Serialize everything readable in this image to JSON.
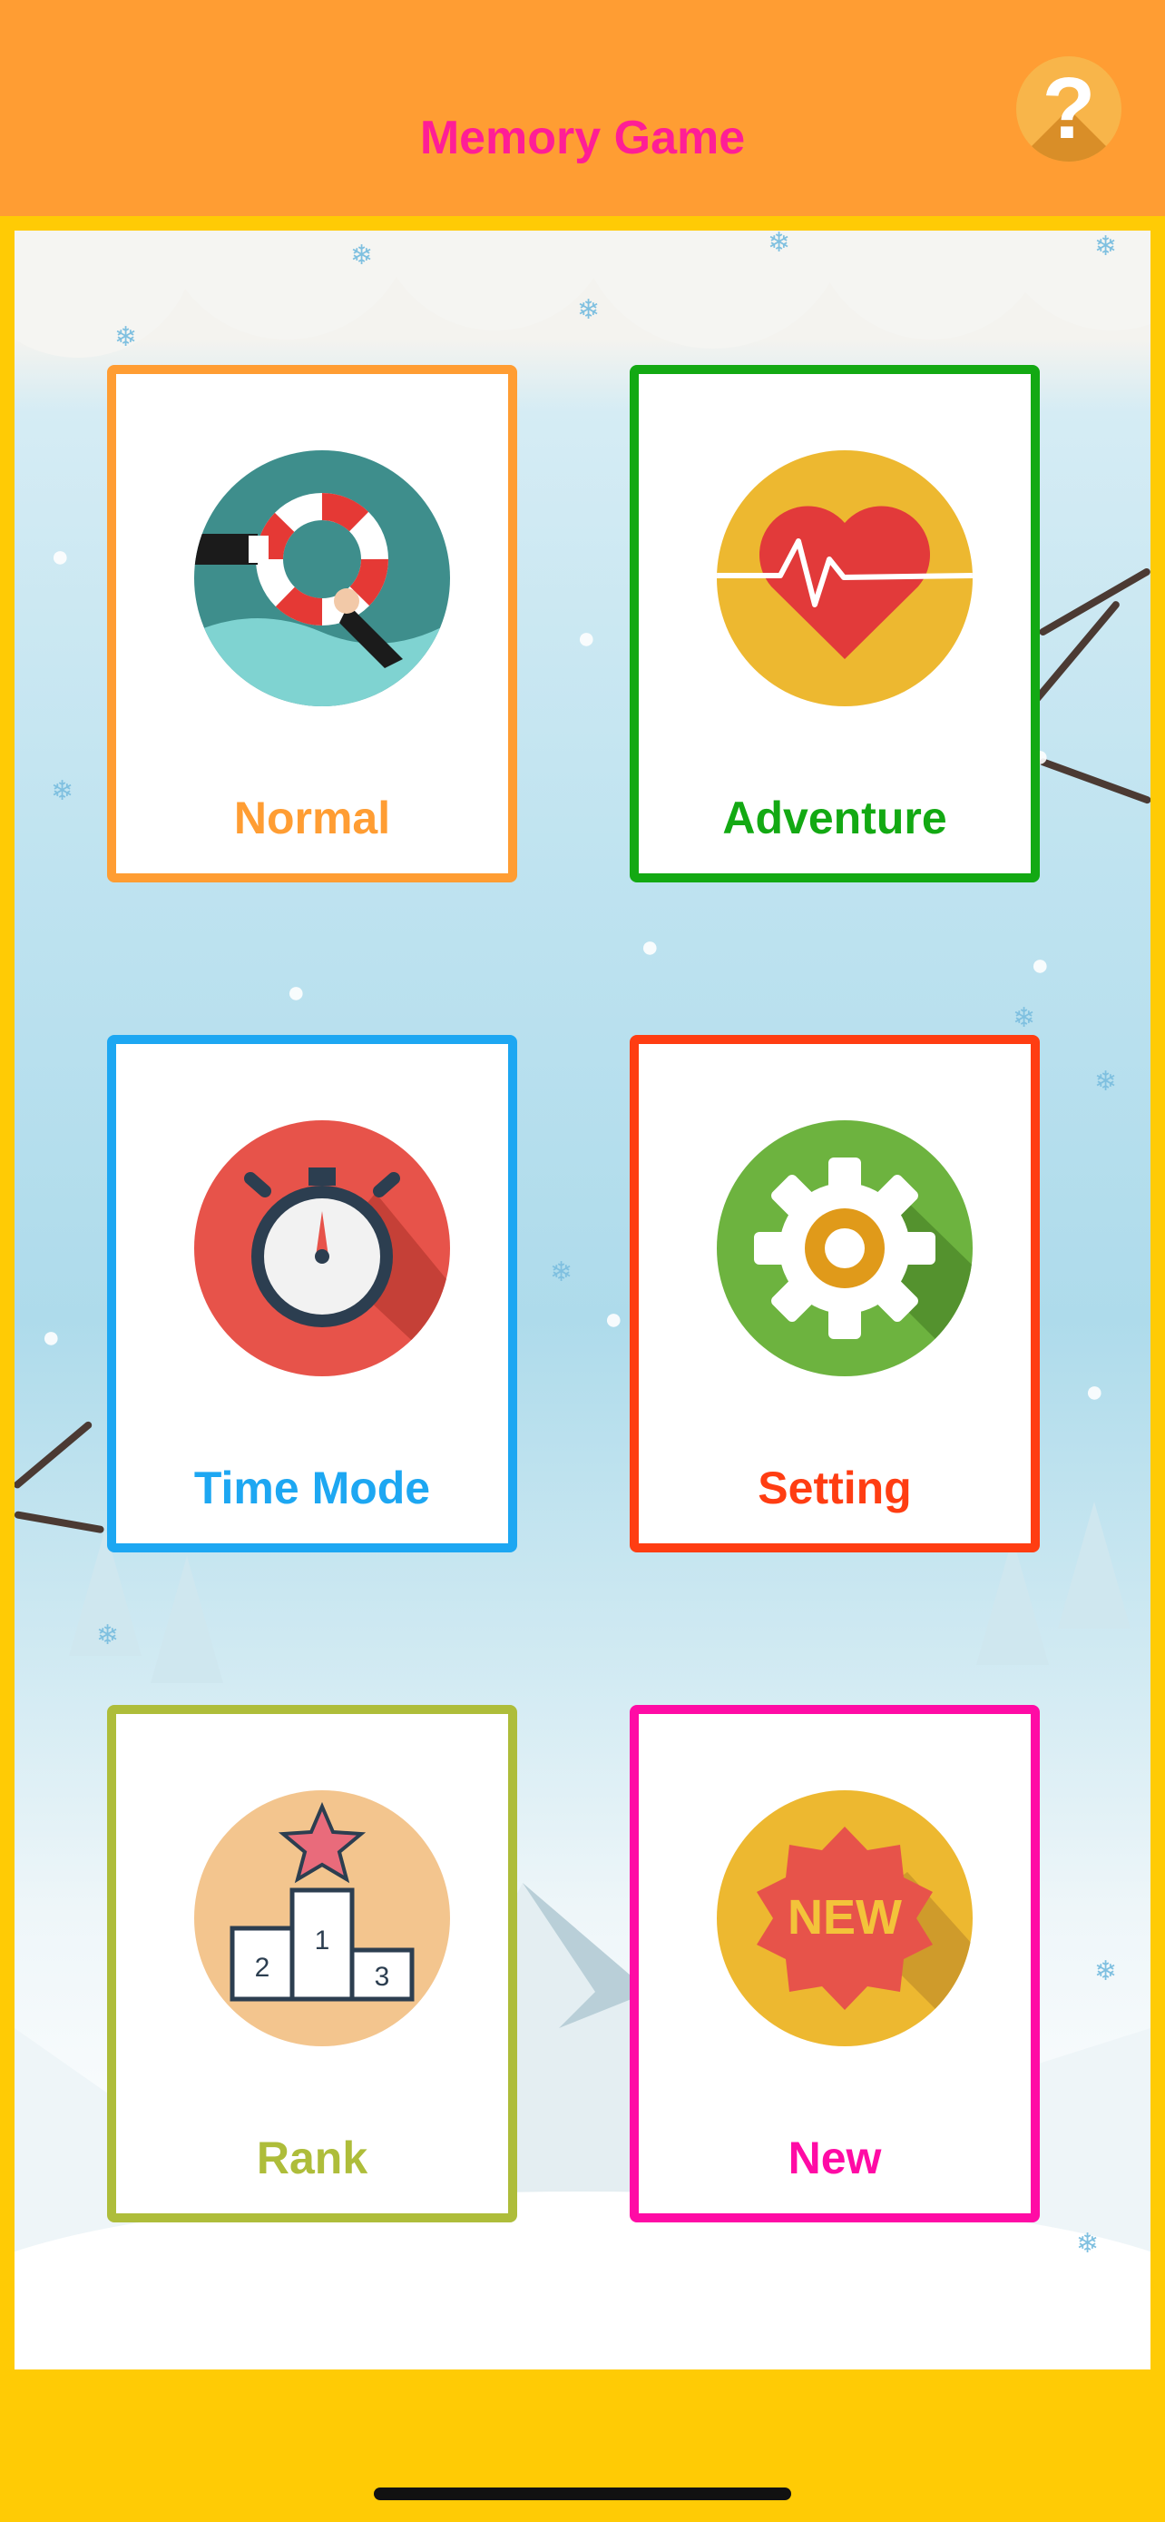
{
  "header": {
    "title": "Memory Game",
    "help_icon": "question-mark-icon",
    "help_glyph": "?"
  },
  "colors": {
    "header_bg": "#FF9D33",
    "title": "#FF1E96",
    "frame": "#FFCB05"
  },
  "menu": [
    {
      "id": "normal",
      "label": "Normal",
      "color": "#FF9D33",
      "icon": "lifebuoy-icon"
    },
    {
      "id": "adventure",
      "label": "Adventure",
      "color": "#13A913",
      "icon": "heartbeat-icon"
    },
    {
      "id": "time-mode",
      "label": "Time Mode",
      "color": "#1DA7F2",
      "icon": "stopwatch-icon"
    },
    {
      "id": "setting",
      "label": "Setting",
      "color": "#FF3D12",
      "icon": "gear-icon"
    },
    {
      "id": "rank",
      "label": "Rank",
      "color": "#AEBD3A",
      "icon": "podium-icon"
    },
    {
      "id": "new",
      "label": "New",
      "color": "#FF0BA5",
      "icon": "new-badge-icon",
      "badge_text": "NEW"
    }
  ],
  "podium": {
    "first": "1",
    "second": "2",
    "third": "3"
  }
}
